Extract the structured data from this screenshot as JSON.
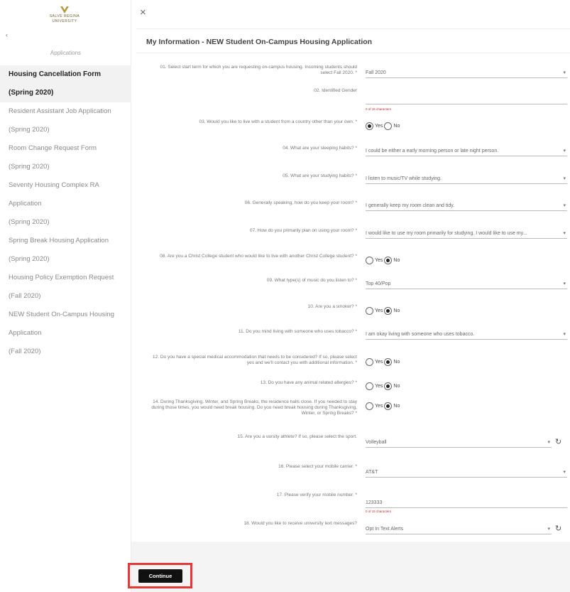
{
  "logo": {
    "line1": "SALVE REGINA",
    "line2": "UNIVERSITY"
  },
  "sidebar": {
    "collapse": "‹",
    "heading": "Applications",
    "items": [
      {
        "lines": [
          "Housing Cancellation Form",
          "(Spring 2020)"
        ],
        "active": true
      },
      {
        "lines": [
          "Resident Assistant Job Application",
          "(Spring 2020)"
        ],
        "active": false
      },
      {
        "lines": [
          "Room Change Request Form",
          "(Spring 2020)"
        ],
        "active": false
      },
      {
        "lines": [
          "Seventy Housing Complex RA",
          "Application",
          "(Spring 2020)"
        ],
        "active": false
      },
      {
        "lines": [
          "Spring Break Housing Application",
          "(Spring 2020)"
        ],
        "active": false
      },
      {
        "lines": [
          "Housing Policy Exemption Request",
          "(Fall 2020)"
        ],
        "active": false
      },
      {
        "lines": [
          "NEW Student On-Campus Housing",
          "Application",
          "(Fall 2020)"
        ],
        "active": false
      }
    ]
  },
  "close_icon": "×",
  "main": {
    "title": "My Information - NEW Student On-Campus Housing Application",
    "questions": [
      {
        "label": "01. Select start term for which you are requesting on-campus housing. Incoming students should select Fall 2020. *",
        "type": "select",
        "value": "Fall 2020"
      },
      {
        "label": "02. Identified Gender",
        "type": "text",
        "value": "",
        "hint": "0 of 15 characters"
      },
      {
        "label": "03. Would you like to live with a student from a country other than your own. *",
        "type": "radio",
        "yes": "Yes",
        "no": "No",
        "selected": "yes"
      },
      {
        "label": "04. What are your sleeping habits? *",
        "type": "select",
        "value": "I could be either a early morning person or late night person."
      },
      {
        "label": "05. What are your studying habits? *",
        "type": "select",
        "value": "I listen to music/TV while studying."
      },
      {
        "label": "06. Generally speaking, how do you keep your room? *",
        "type": "select",
        "value": "I generally keep my room clean and tidy."
      },
      {
        "label": "07. How do you primarily plan on using your room? *",
        "type": "select",
        "value": "I would like to use my room primarily for studying.  I would like to use my..."
      },
      {
        "label": "08. Are you a Christ College student who would like to live with another Christ College student? *",
        "type": "radio",
        "yes": "Yes",
        "no": "No",
        "selected": "no"
      },
      {
        "label": "09. What type(s) of music do you listen to? *",
        "type": "select",
        "value": "Top 40/Pop"
      },
      {
        "label": "10. Are you a smoker? *",
        "type": "radio",
        "yes": "Yes",
        "no": "No",
        "selected": "no"
      },
      {
        "label": "11. Do you mind living with someone who uses tobacco? *",
        "type": "select",
        "value": "I am okay living with someone who uses tobacco."
      },
      {
        "label": "12. Do you have a special medical accommodation that needs to be considered? If so, please select yes and we'll contact you with additional information. *",
        "type": "radio",
        "yes": "Yes",
        "no": "No",
        "selected": "no"
      },
      {
        "label": "13. Do you have any animal related allergies? *",
        "type": "radio",
        "yes": "Yes",
        "no": "No",
        "selected": "no"
      },
      {
        "label": "14. During Thanksgiving, Winter, and Spring Breaks, the residence halls close. If you needed to stay during those times, you would need break housing. Do you need break housing during Thanksgiving, Winter, or Spring Breaks? *",
        "type": "radio",
        "yes": "Yes",
        "no": "No",
        "selected": "no"
      },
      {
        "label": "15. Are you a varsity athlete? If so, please select the sport.",
        "type": "select-refresh",
        "value": "Volleyball"
      },
      {
        "label": "16. Please select your mobile carrier. *",
        "type": "select",
        "value": "AT&T"
      },
      {
        "label": "17. Please verify your mobile number. *",
        "type": "text",
        "value": "123333",
        "hint": "0 of 15 characters"
      },
      {
        "label": "18. Would you like to receive university text messages?",
        "type": "select-refresh",
        "value": "Opt In Text Alerts"
      }
    ]
  },
  "footer": {
    "continue_label": "Continue"
  },
  "colors": {
    "highlight": "#e53935",
    "button": "#111111",
    "active_nav": "#f2f2f2"
  }
}
